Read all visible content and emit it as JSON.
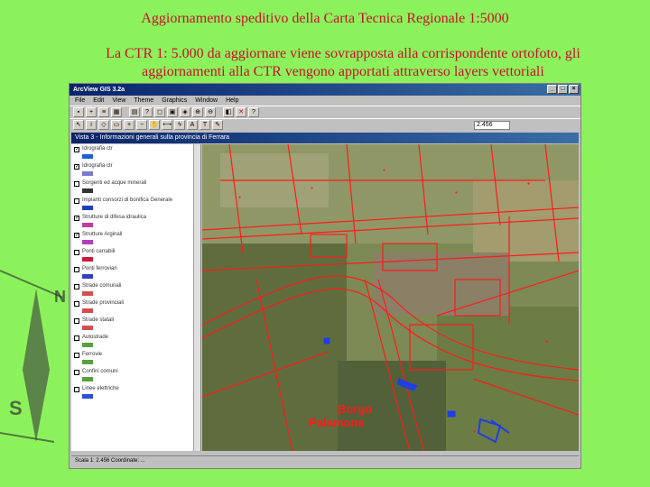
{
  "slide": {
    "title": "Aggiornamento speditivo della Carta Tecnica Regionale 1:5000",
    "subtitle": "La CTR 1: 5.000  da aggiornare viene sovrapposta alla corrispondente ortofoto, gli aggiornamenti alla CTR vengono apportati attraverso layers vettoriali"
  },
  "window": {
    "title": "ArcView GIS 3.2a",
    "menu": [
      "File",
      "Edit",
      "View",
      "Theme",
      "Graphics",
      "Window",
      "Help"
    ],
    "scale_value": "2.456",
    "view_title": "Vista 3 - Informazioni generali sulla provincia di Ferrara"
  },
  "legend": {
    "items": [
      {
        "label": "Idrografia ctr",
        "checked": true,
        "color": "#1f5fd6"
      },
      {
        "label": "Idrografia ctr",
        "checked": true,
        "color": "#7a7acc"
      },
      {
        "label": "Sorgenti ed acque minerali",
        "checked": false,
        "color": "#333333"
      },
      {
        "label": "Impianti consorzi di bonifica Generale",
        "checked": false,
        "color": "#1f3fbf"
      },
      {
        "label": "Strutture di difesa idraulica",
        "checked": true,
        "color": "#c43c9c"
      },
      {
        "label": "Strutture Arginali",
        "checked": true,
        "color": "#b040c0"
      },
      {
        "label": "Ponti carrabili",
        "checked": false,
        "color": "#c41e3a"
      },
      {
        "label": "Ponti ferroviari",
        "checked": false,
        "color": "#3040c0"
      },
      {
        "label": "Strade comunali",
        "checked": false,
        "color": "#d05050"
      },
      {
        "label": "Strade provinciali",
        "checked": false,
        "color": "#d05050"
      },
      {
        "label": "Strade statali",
        "checked": false,
        "color": "#d05050"
      },
      {
        "label": "Autostrade",
        "checked": false,
        "color": "#58a040"
      },
      {
        "label": "Ferrovie",
        "checked": false,
        "color": "#58a040"
      },
      {
        "label": "Confini comuni",
        "checked": false,
        "color": "#58a040"
      },
      {
        "label": "Linee elettriche",
        "checked": false,
        "color": "#3050d0"
      }
    ]
  },
  "map": {
    "place_label_1": "Borgo",
    "place_label_2": "Palamone"
  },
  "status": "Scala 1:  2.456   Coordinate: ..."
}
